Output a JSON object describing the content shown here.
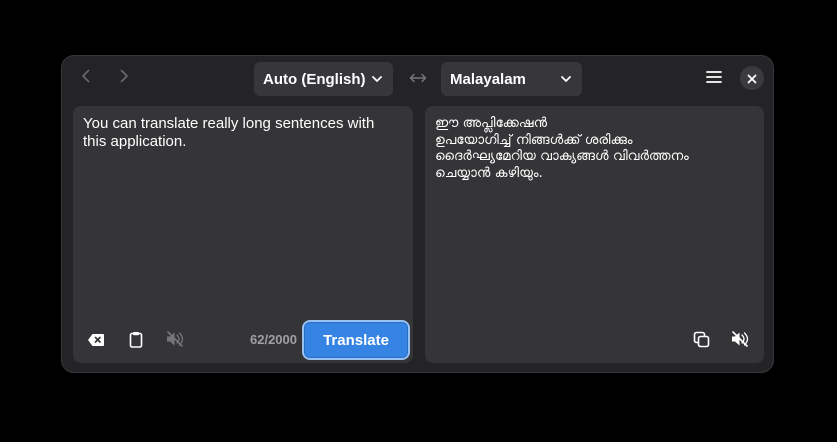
{
  "header": {
    "back_icon": "go-previous-icon",
    "forward_icon": "go-next-icon",
    "source_language": "Auto (English)",
    "swap_icon": "swap-arrows-icon",
    "target_language": "Malayalam",
    "menu_icon": "hamburger-menu-icon",
    "close_icon": "close-icon"
  },
  "source": {
    "text": "You can translate really long sentences with this application.",
    "char_count": "62/2000",
    "translate_label": "Translate",
    "clear_icon": "clear-text-icon",
    "paste_icon": "clipboard-paste-icon",
    "listen_icon": "speaker-muted-icon"
  },
  "target": {
    "text": "ഈ അപ്ലിക്കേഷൻ\nഉപയോഗിച്ച് നിങ്ങൾക്ക് ശരിക്കും\nദൈർഘ്യമേറിയ വാക്യങ്ങൾ വിവർത്തനം\nചെയ്യാൻ കഴിയും.",
    "copy_icon": "copy-icon",
    "listen_icon": "speaker-icon"
  },
  "colors": {
    "accent": "#3584e4",
    "window_bg": "#242427",
    "pane_bg": "#353538"
  }
}
